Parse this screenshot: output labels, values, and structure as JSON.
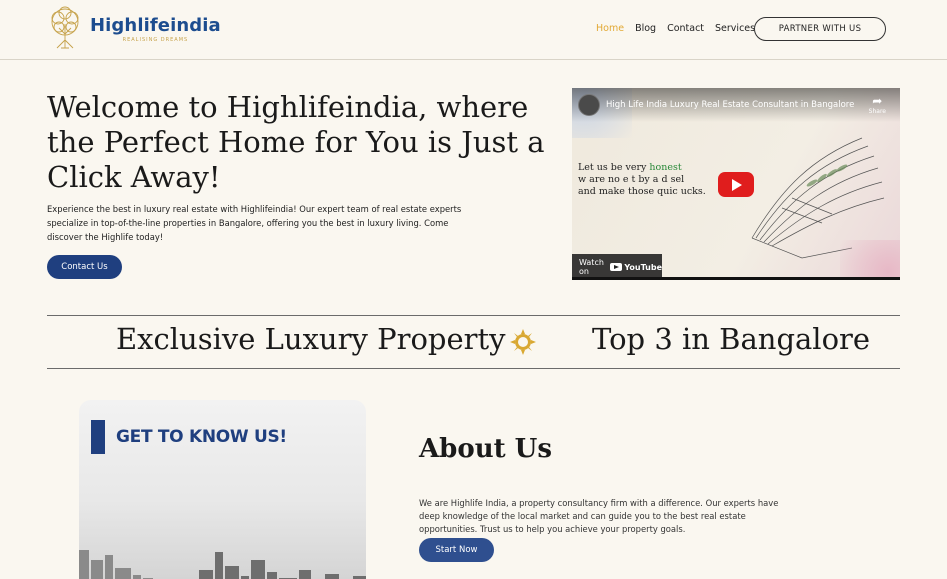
{
  "brand": {
    "name": "Highlifeindia",
    "tagline": "REALISING DREAMS"
  },
  "nav": {
    "items": [
      {
        "label": "Home",
        "active": true
      },
      {
        "label": "Blog",
        "active": false
      },
      {
        "label": "Contact",
        "active": false
      },
      {
        "label": "Services",
        "active": false
      }
    ],
    "partner_label": "PARTNER WITH US"
  },
  "hero": {
    "title": "Welcome to Highlifeindia, where the Perfect Home for You is Just a Click Away!",
    "description": "Experience the best in luxury real estate with Highlifeindia! Our expert team of real estate experts specialize in top-of-the-line properties in Bangalore, offering you the best in luxury living. Come discover the Highlife today!",
    "cta_label": "Contact Us"
  },
  "video": {
    "title": "High Life India Luxury Real Estate Consultant in Bangalore",
    "share_label": "Share",
    "caption_line1_a": "Let us be very ",
    "caption_line1_b": "honest",
    "caption_line2": "w   are no     e   t   by a  d sel",
    "caption_line3": "and make those quic       ucks.",
    "watch_label": "Watch on",
    "youtube_label": "YouTube"
  },
  "strip": {
    "left_text": "Exclusive Luxury Property",
    "right_text": "Top 3 in Bangalore"
  },
  "about": {
    "card_title": "GET TO KNOW US!",
    "title": "About Us",
    "description": "We are Highlife India, a property consultancy firm with a difference. Our experts have deep knowledge of the local market and can guide you to the best real estate opportunities. Trust us to help you achieve your property goals.",
    "cta_label": "Start Now"
  },
  "colors": {
    "background": "#faf7f0",
    "primary": "#1f3f7f",
    "accent_gold": "#e2a935",
    "brand_blue": "#1d4d8f"
  }
}
